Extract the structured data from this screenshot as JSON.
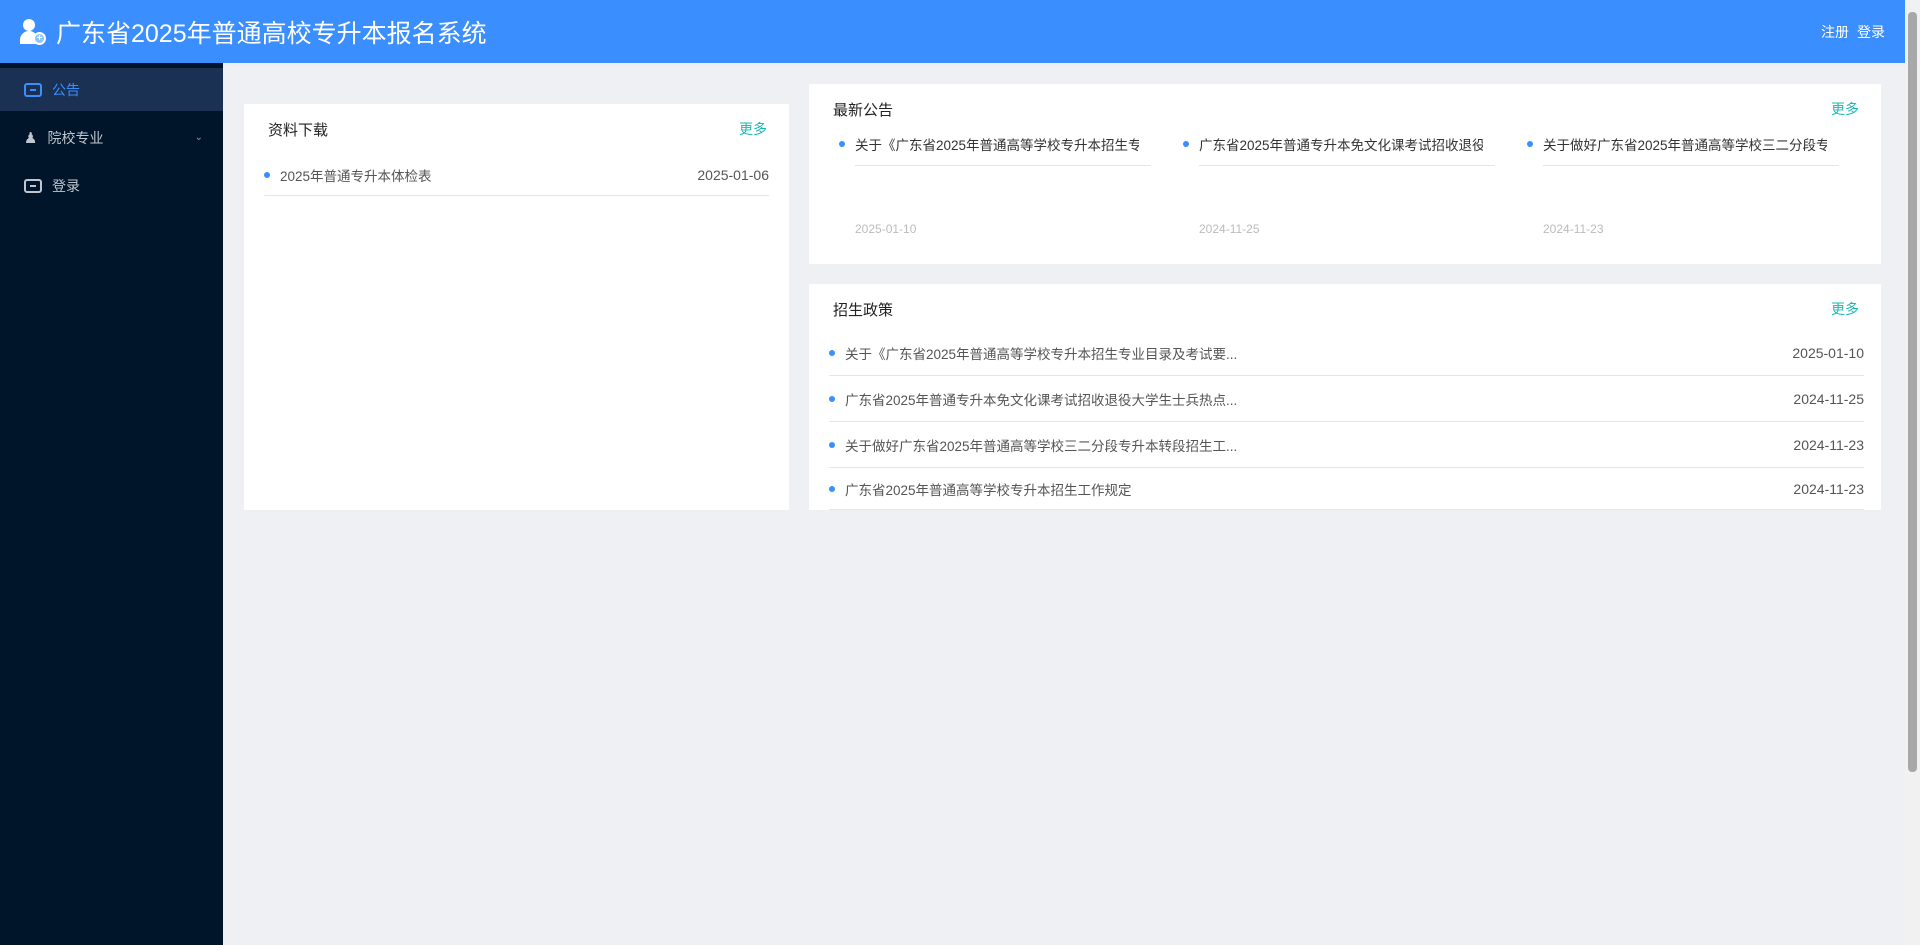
{
  "header": {
    "title": "广东省2025年普通高校专升本报名系统",
    "register": "注册",
    "login": "登录"
  },
  "sidebar": {
    "items": [
      {
        "label": "公告"
      },
      {
        "label": "院校专业"
      },
      {
        "label": "登录"
      }
    ]
  },
  "downloads": {
    "title": "资料下载",
    "more": "更多",
    "items": [
      {
        "title": "2025年普通专升本体检表",
        "date": "2025-01-06"
      }
    ]
  },
  "announcements": {
    "title": "最新公告",
    "more": "更多",
    "items": [
      {
        "title": "关于《广东省2025年普通高等学校专升本招生专",
        "date": "2025-01-10"
      },
      {
        "title": "广东省2025年普通专升本免文化课考试招收退役",
        "date": "2024-11-25"
      },
      {
        "title": "关于做好广东省2025年普通高等学校三二分段专",
        "date": "2024-11-23"
      }
    ]
  },
  "policy": {
    "title": "招生政策",
    "more": "更多",
    "items": [
      {
        "title": "关于《广东省2025年普通高等学校专升本招生专业目录及考试要...",
        "date": "2025-01-10"
      },
      {
        "title": "广东省2025年普通专升本免文化课考试招收退役大学生士兵热点...",
        "date": "2024-11-25"
      },
      {
        "title": "关于做好广东省2025年普通高等学校三二分段专升本转段招生工...",
        "date": "2024-11-23"
      },
      {
        "title": "广东省2025年普通高等学校专升本招生工作规定",
        "date": "2024-11-23"
      }
    ]
  }
}
